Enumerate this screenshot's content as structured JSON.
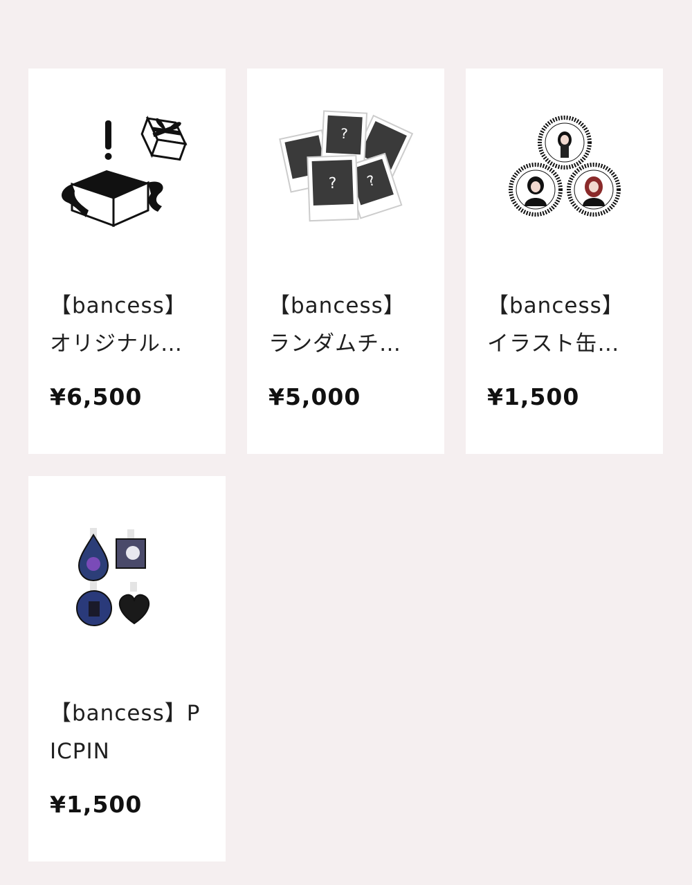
{
  "products": [
    {
      "title_line1": "【bancess】",
      "title_line2": "オリジナル…",
      "price": "¥6,500",
      "icon": "gift-box-icon"
    },
    {
      "title_line1": "【bancess】",
      "title_line2": "ランダムチ…",
      "price": "¥5,000",
      "icon": "random-cheki-icon"
    },
    {
      "title_line1": "【bancess】",
      "title_line2": "イラスト缶…",
      "price": "¥1,500",
      "icon": "illustration-badges-icon"
    },
    {
      "title_line1": "【bancess】P",
      "title_line2": "ICPIN",
      "price": "¥1,500",
      "icon": "picpin-set-icon"
    }
  ],
  "colors": {
    "background": "#f5eff0",
    "card": "#ffffff",
    "text": "#1f1f1f"
  }
}
